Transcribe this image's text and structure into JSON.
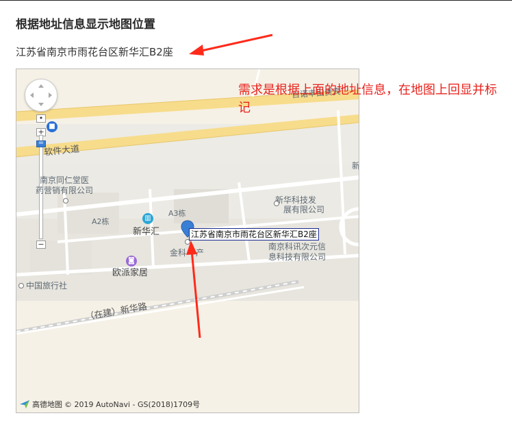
{
  "page": {
    "title": "根据地址信息显示地图位置",
    "address": "江苏省南京市雨花台区新华汇B2座"
  },
  "annotation": {
    "text": "需求是根据上面的地址信息，在地图上回显并标记"
  },
  "map": {
    "marker_label": "江苏省南京市雨花台区新华汇B2座",
    "labels": {
      "software_ave": "软件大道",
      "tongrentang": "南京同仁堂医",
      "tongrentang2": "药营销有限公司",
      "a2": "A2栋",
      "a3": "A3栋",
      "xinhuahui": "新华汇",
      "jinke": "金科",
      "jinke2": "产",
      "xinhua_tech": "新华科技发",
      "xinhua_tech2": "展有限公司",
      "xunshi": "南京科讯次元信",
      "xunshi2": "息科技有限公司",
      "oupai": "欧派家居",
      "cits": "中国旅行社",
      "xinhua_road": "（在建）新华路",
      "top_right": "百诺丰田贵宾",
      "xin_edge": "新"
    },
    "attribution_brand": "高德地图",
    "attribution_text": "© 2019 AutoNavi - GS(2018)1709号",
    "zoom_plus": "+",
    "zoom_minus": "−"
  },
  "colors": {
    "annotation_red": "#e8231d",
    "marker_blue": "#3a7fd6",
    "map_bg": "#f6f1e6"
  }
}
